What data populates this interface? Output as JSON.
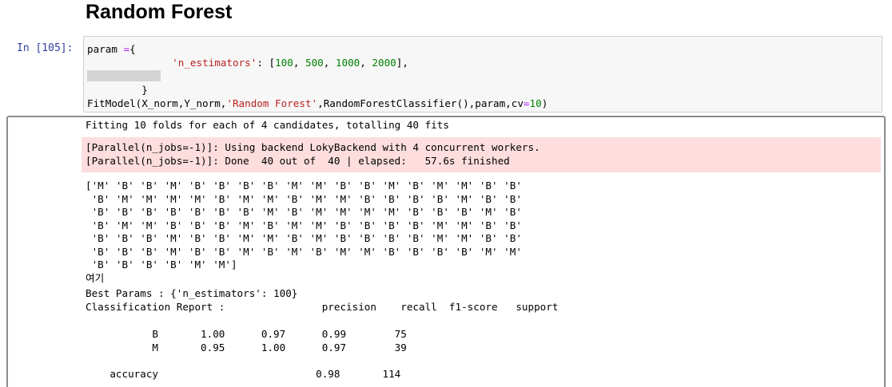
{
  "cell": {
    "heading": "Random Forest",
    "prompt": "In [105]:",
    "code": {
      "l1_a": "param ",
      "l1_op": "=",
      "l1_b": "{",
      "l2_str": "'n_estimators'",
      "l2_b": ": [",
      "l2_n1": "100",
      "l2_n2": "500",
      "l2_n3": "1000",
      "l2_n4": "2000",
      "l2_end": "],",
      "l4": "}",
      "l5_a": "FitModel(X_norm,Y_norm,",
      "l5_str": "'Random Forest'",
      "l5_b": ",RandomForestClassifier(),param,cv",
      "l5_op": "=",
      "l5_num": "10",
      "l5_end": ")"
    }
  },
  "output": {
    "fitting": "Fitting 10 folds for each of 4 candidates, totalling 40 fits",
    "stderr": "[Parallel(n_jobs=-1)]: Using backend LokyBackend with 4 concurrent workers.\n[Parallel(n_jobs=-1)]: Done  40 out of  40 | elapsed:   57.6s finished",
    "predictions": "['M' 'B' 'B' 'M' 'B' 'B' 'B' 'B' 'M' 'M' 'B' 'B' 'M' 'B' 'M' 'M' 'B' 'B'\n 'B' 'M' 'M' 'M' 'M' 'B' 'M' 'M' 'B' 'M' 'M' 'B' 'B' 'B' 'B' 'M' 'B' 'B'\n 'B' 'B' 'B' 'B' 'B' 'B' 'B' 'M' 'B' 'M' 'M' 'M' 'M' 'B' 'B' 'B' 'M' 'B'\n 'B' 'M' 'M' 'B' 'B' 'B' 'M' 'B' 'M' 'M' 'B' 'B' 'B' 'B' 'M' 'M' 'B' 'B'\n 'B' 'B' 'B' 'M' 'B' 'B' 'M' 'M' 'B' 'M' 'B' 'B' 'B' 'B' 'M' 'M' 'B' 'B'\n 'B' 'B' 'B' 'M' 'B' 'B' 'M' 'B' 'M' 'B' 'M' 'M' 'B' 'B' 'B' 'B' 'M' 'M'\n 'B' 'B' 'B' 'B' 'M' 'M']",
    "korean_note": "여기",
    "best_params": "Best Params : {'n_estimators': 100}",
    "report_header": "Classification Report :                precision    recall  f1-score   support",
    "report_rows": "           B       1.00      0.97      0.99        75\n           M       0.95      1.00      0.97        39\n\n    accuracy                          0.98       114"
  }
}
